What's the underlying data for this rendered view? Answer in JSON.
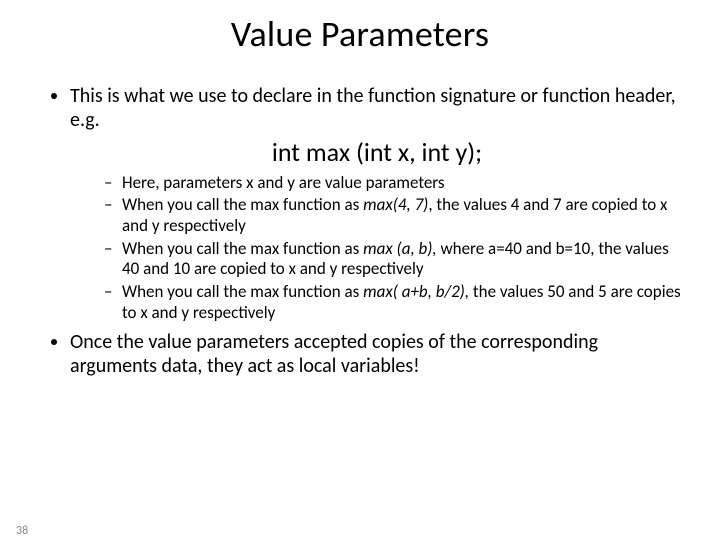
{
  "title": "Value Parameters",
  "bullets": {
    "b1": "This is what we use to declare in the function signature or function header, e.g.",
    "signature": "int max (int x, int y);",
    "sub": {
      "s1": "Here, parameters x and y are value parameters",
      "s2a": "When you call the max function as ",
      "s2call": "max(4, 7)",
      "s2b": ", the values 4 and 7 are copied to x and y respectively",
      "s3a": "When you call the max function as ",
      "s3call": "max (a, b),",
      "s3b": " where a=40 and b=10, the values 40 and 10 are copied to x and y respectively",
      "s4a": "When you call the max function as ",
      "s4call": "max( a+b, b/2),",
      "s4b": " the values 50 and 5 are copies to x and y respectively"
    },
    "b2": "Once the value parameters accepted copies of the corresponding arguments data, they act as local variables!"
  },
  "page_number": "38"
}
